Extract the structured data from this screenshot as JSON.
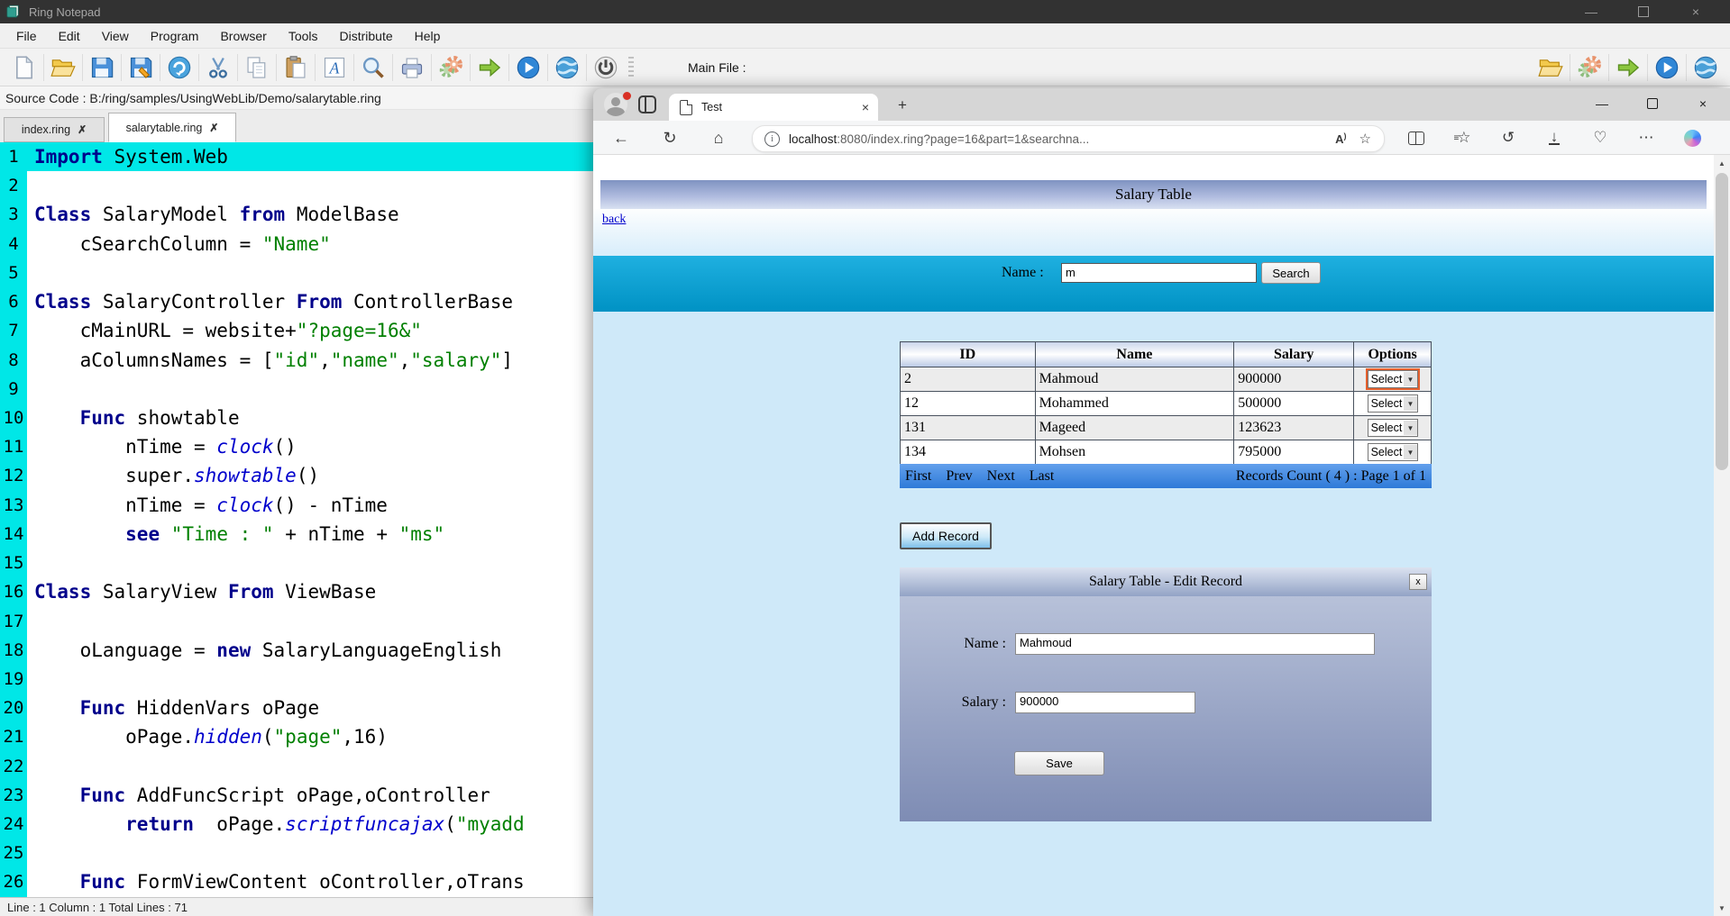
{
  "colors": {
    "notepad_titlebar": "#323232",
    "gutter_cyan": "#00e7e7",
    "keyword": "#00008b",
    "string": "#008000",
    "function_call": "#0000cc",
    "page_background": "#cfe9f9",
    "search_band_top": "#1fb0e0",
    "search_band_bottom": "#0092c4",
    "pagination_blue": "#2e7ad8",
    "select_focus_outline": "#e4602e",
    "link_blue": "#0000cc"
  },
  "notepad": {
    "window_title": "Ring Notepad",
    "window_controls": [
      "minimize",
      "maximize",
      "close"
    ],
    "menu_items": [
      "File",
      "Edit",
      "View",
      "Program",
      "Browser",
      "Tools",
      "Distribute",
      "Help"
    ],
    "toolbar_left_icons": [
      "new-file",
      "open-folder",
      "save",
      "save-as",
      "reload",
      "cut",
      "copy",
      "paste",
      "font",
      "find",
      "print",
      "settings-gear",
      "run-arrow",
      "play",
      "web-globe",
      "power"
    ],
    "main_file_label": "Main File :",
    "toolbar_right_icons": [
      "open-folder",
      "settings-gear",
      "run-arrow",
      "play",
      "web-globe"
    ],
    "source_path_label": "Source Code : B:/ring/samples/UsingWebLib/Demo/salarytable.ring",
    "editor_tabs": [
      {
        "label": "index.ring",
        "close_glyph": "✗",
        "active": false
      },
      {
        "label": "salarytable.ring",
        "close_glyph": "✗",
        "active": true
      }
    ],
    "status_bar": "Line : 1 Column : 1 Total Lines : 71",
    "code_lines": [
      {
        "n": 1,
        "hl": true,
        "seg": [
          [
            "kw",
            "Import"
          ],
          [
            "pl",
            " System.Web"
          ]
        ]
      },
      {
        "n": 2,
        "seg": []
      },
      {
        "n": 3,
        "seg": [
          [
            "kw",
            "Class"
          ],
          [
            "pl",
            " SalaryModel "
          ],
          [
            "kw",
            "from"
          ],
          [
            "pl",
            " ModelBase"
          ]
        ]
      },
      {
        "n": 4,
        "seg": [
          [
            "pl",
            "    cSearchColumn = "
          ],
          [
            "str",
            "\"Name\""
          ]
        ]
      },
      {
        "n": 5,
        "seg": []
      },
      {
        "n": 6,
        "seg": [
          [
            "kw",
            "Class"
          ],
          [
            "pl",
            " SalaryController "
          ],
          [
            "kw",
            "From"
          ],
          [
            "pl",
            " ControllerBase"
          ]
        ]
      },
      {
        "n": 7,
        "seg": [
          [
            "pl",
            "    cMainURL = website+"
          ],
          [
            "str",
            "\"?page=16&\""
          ]
        ]
      },
      {
        "n": 8,
        "seg": [
          [
            "pl",
            "    aColumnsNames = ["
          ],
          [
            "str",
            "\"id\""
          ],
          [
            "pl",
            ","
          ],
          [
            "str",
            "\"name\""
          ],
          [
            "pl",
            ","
          ],
          [
            "str",
            "\"salary\""
          ],
          [
            "pl",
            "]"
          ]
        ]
      },
      {
        "n": 9,
        "seg": []
      },
      {
        "n": 10,
        "seg": [
          [
            "pl",
            "    "
          ],
          [
            "kw",
            "Func"
          ],
          [
            "pl",
            " showtable"
          ]
        ]
      },
      {
        "n": 11,
        "seg": [
          [
            "pl",
            "        nTime = "
          ],
          [
            "fn",
            "clock"
          ],
          [
            "pl",
            "()"
          ]
        ]
      },
      {
        "n": 12,
        "seg": [
          [
            "pl",
            "        super."
          ],
          [
            "fn",
            "showtable"
          ],
          [
            "pl",
            "()"
          ]
        ]
      },
      {
        "n": 13,
        "seg": [
          [
            "pl",
            "        nTime = "
          ],
          [
            "fn",
            "clock"
          ],
          [
            "pl",
            "() - nTime"
          ]
        ]
      },
      {
        "n": 14,
        "seg": [
          [
            "pl",
            "        "
          ],
          [
            "kw",
            "see"
          ],
          [
            "pl",
            " "
          ],
          [
            "str",
            "\"Time : \""
          ],
          [
            "pl",
            " + nTime + "
          ],
          [
            "str",
            "\"ms\""
          ]
        ]
      },
      {
        "n": 15,
        "seg": []
      },
      {
        "n": 16,
        "seg": [
          [
            "kw",
            "Class"
          ],
          [
            "pl",
            " SalaryView "
          ],
          [
            "kw",
            "From"
          ],
          [
            "pl",
            " ViewBase"
          ]
        ]
      },
      {
        "n": 17,
        "seg": []
      },
      {
        "n": 18,
        "seg": [
          [
            "pl",
            "    oLanguage = "
          ],
          [
            "kw",
            "new"
          ],
          [
            "pl",
            " SalaryLanguageEnglish"
          ]
        ]
      },
      {
        "n": 19,
        "seg": []
      },
      {
        "n": 20,
        "seg": [
          [
            "pl",
            "    "
          ],
          [
            "kw",
            "Func"
          ],
          [
            "pl",
            " HiddenVars oPage"
          ]
        ]
      },
      {
        "n": 21,
        "seg": [
          [
            "pl",
            "        oPage."
          ],
          [
            "fn",
            "hidden"
          ],
          [
            "pl",
            "("
          ],
          [
            "str",
            "\"page\""
          ],
          [
            "pl",
            ",16)"
          ]
        ]
      },
      {
        "n": 22,
        "seg": []
      },
      {
        "n": 23,
        "seg": [
          [
            "pl",
            "    "
          ],
          [
            "kw",
            "Func"
          ],
          [
            "pl",
            " AddFuncScript oPage,oController"
          ]
        ]
      },
      {
        "n": 24,
        "seg": [
          [
            "pl",
            "        "
          ],
          [
            "kw",
            "return"
          ],
          [
            "pl",
            "  oPage."
          ],
          [
            "fn",
            "scriptfuncajax"
          ],
          [
            "pl",
            "("
          ],
          [
            "str",
            "\"myadd"
          ]
        ]
      },
      {
        "n": 25,
        "seg": []
      },
      {
        "n": 26,
        "seg": [
          [
            "pl",
            "    "
          ],
          [
            "kw",
            "Func"
          ],
          [
            "pl",
            " FormViewContent oController,oTrans"
          ]
        ]
      }
    ]
  },
  "browser": {
    "tab_title": "Test",
    "new_tab_button": "+",
    "window_controls": [
      "minimize",
      "maximize",
      "close"
    ],
    "nav_icons_left": [
      "back-arrow",
      "reload",
      "home"
    ],
    "url": {
      "host": "localhost",
      "rest": ":8080/index.ring?page=16&part=1&searchna..."
    },
    "url_pill_icons": [
      "info",
      "read-aloud",
      "favorite-star"
    ],
    "nav_icons_right": [
      "split-screen",
      "favorites",
      "history",
      "downloads",
      "browser-essentials",
      "more-options",
      "copilot"
    ],
    "page": {
      "title": "Salary Table",
      "back_link": "back",
      "search": {
        "label": "Name :",
        "value": "m",
        "button_label": "Search"
      },
      "table": {
        "headers": [
          "ID",
          "Name",
          "Salary",
          "Options"
        ],
        "rows": [
          {
            "id": "2",
            "name": "Mahmoud",
            "salary": "900000"
          },
          {
            "id": "12",
            "name": "Mohammed",
            "salary": "500000"
          },
          {
            "id": "131",
            "name": "Mageed",
            "salary": "123623"
          },
          {
            "id": "134",
            "name": "Mohsen",
            "salary": "795000"
          }
        ],
        "select_label": "Select",
        "focused_select_row": 0
      },
      "pagination": {
        "links": [
          "First",
          "Prev",
          "Next",
          "Last"
        ],
        "info": "Records Count ( 4 ) : Page 1 of 1"
      },
      "add_record_label": "Add Record",
      "edit_panel": {
        "title": "Salary Table - Edit Record",
        "close_label": "x",
        "name_label": "Name :",
        "name_value": "Mahmoud",
        "salary_label": "Salary :",
        "salary_value": "900000",
        "save_label": "Save"
      }
    }
  }
}
